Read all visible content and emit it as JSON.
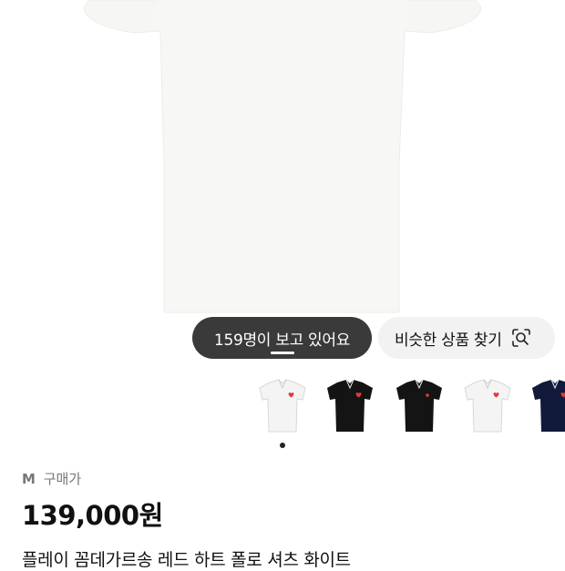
{
  "viewers_pill": {
    "text": "159명이 보고 있어요"
  },
  "similar_button": {
    "label": "비슷한 상품 찾기",
    "icon": "lens-search-icon"
  },
  "thumbnails": [
    {
      "color": "white",
      "fill": "#f4f4f4",
      "heart": "#e03a3a"
    },
    {
      "color": "black",
      "fill": "#141414",
      "heart": "#e03a3a"
    },
    {
      "color": "black",
      "fill": "#141414",
      "heart": "#e03a3a"
    },
    {
      "color": "white",
      "fill": "#f4f4f4",
      "heart": "#e03a3a"
    },
    {
      "color": "navy",
      "fill": "#111a3a",
      "heart": "#e03a3a"
    }
  ],
  "carousel": {
    "active_index": 0
  },
  "product": {
    "size_label": "M",
    "price_type": "구매가",
    "price": "139,000원",
    "name": "플레이 꼼데가르송 레드 하트 폴로 셔츠 화이트"
  },
  "colors": {
    "accent_dark": "#3a3a3a",
    "chip_light": "#f2f2f2",
    "heart_red": "#e03a3a"
  }
}
